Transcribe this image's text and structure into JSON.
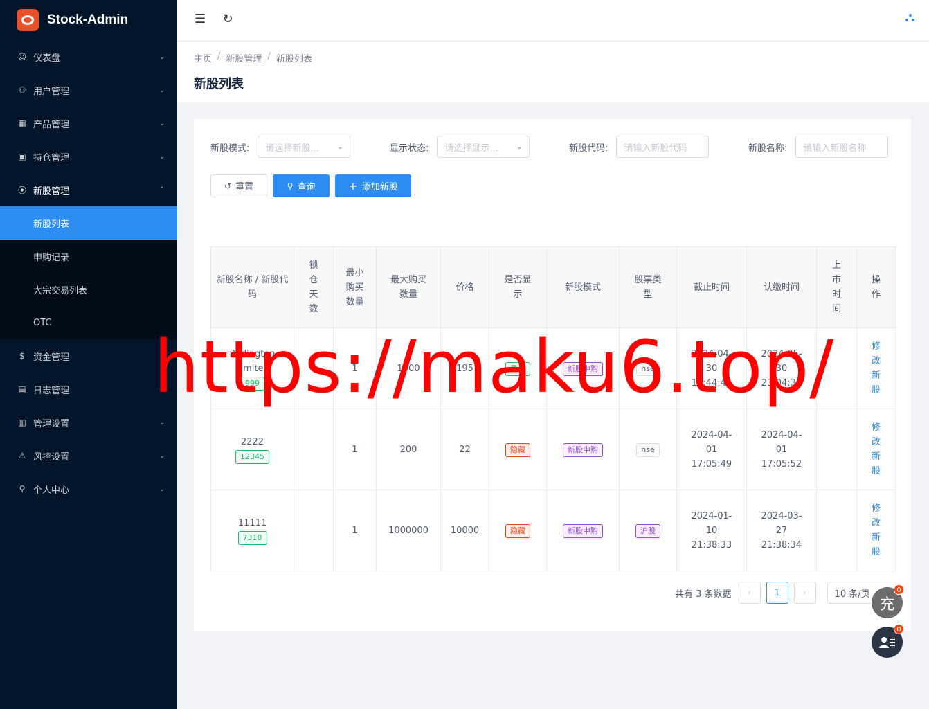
{
  "app": {
    "title": "Stock-Admin"
  },
  "sidebar": {
    "items": [
      {
        "label": "仪表盘",
        "icon": "dashboard-icon",
        "glyph": "☺",
        "arrow": "⌄"
      },
      {
        "label": "用户管理",
        "icon": "users-icon",
        "glyph": "⚇",
        "arrow": "⌄"
      },
      {
        "label": "产品管理",
        "icon": "chart-icon",
        "glyph": "▦",
        "arrow": "⌄"
      },
      {
        "label": "持仓管理",
        "icon": "position-icon",
        "glyph": "▣",
        "arrow": "⌄"
      },
      {
        "label": "新股管理",
        "icon": "ipo-icon",
        "glyph": "⦿",
        "arrow": "⌃"
      },
      {
        "label": "资金管理",
        "icon": "money-icon",
        "glyph": "$",
        "arrow": ""
      },
      {
        "label": "日志管理",
        "icon": "log-icon",
        "glyph": "▤",
        "arrow": ""
      },
      {
        "label": "管理设置",
        "icon": "settings-icon",
        "glyph": "▥",
        "arrow": "⌄"
      },
      {
        "label": "风控设置",
        "icon": "warning-icon",
        "glyph": "⚠",
        "arrow": "⌄"
      },
      {
        "label": "个人中心",
        "icon": "user-icon",
        "glyph": "⚲",
        "arrow": "⌄"
      }
    ],
    "submenu": [
      {
        "label": "新股列表"
      },
      {
        "label": "申购记录"
      },
      {
        "label": "大宗交易列表"
      },
      {
        "label": "OTC"
      }
    ]
  },
  "header": {
    "collapse_icon": "☰",
    "refresh_icon": "↻"
  },
  "breadcrumb": {
    "home": "主页",
    "section": "新股管理",
    "page": "新股列表",
    "sep": "/"
  },
  "page_title": "新股列表",
  "filters": {
    "mode": {
      "label": "新股模式:",
      "placeholder": "请选择新股..."
    },
    "display": {
      "label": "显示状态:",
      "placeholder": "请选择显示..."
    },
    "code": {
      "label": "新股代码:",
      "placeholder": "请输入新股代码"
    },
    "name": {
      "label": "新股名称:",
      "placeholder": "请输入新股名称"
    }
  },
  "buttons": {
    "reset": "重置",
    "search": "查询",
    "add": "添加新股"
  },
  "table": {
    "headers": [
      "新股名称 / 新股代码",
      "锁仓天数",
      "最小购买数量",
      "最大购买数量",
      "价格",
      "是否显示",
      "新股模式",
      "股票类型",
      "截止时间",
      "认缴时间",
      "上市时间",
      "操作"
    ],
    "rows": [
      {
        "name": "Redington Limited",
        "code": "999",
        "lock": "",
        "min": "1",
        "max": "1000",
        "price": "195",
        "show": "显示",
        "mode": "新股申购",
        "type": "nse",
        "deadline": "2024-04-30 10:44:44",
        "subscribe": "2024-05-30 23:04:30",
        "listing": "",
        "op": "修改新股"
      },
      {
        "name": "2222",
        "code": "12345",
        "lock": "",
        "min": "1",
        "max": "200",
        "price": "22",
        "show": "隐藏",
        "mode": "新股申购",
        "type": "nse",
        "deadline": "2024-04-01 17:05:49",
        "subscribe": "2024-04-01 17:05:52",
        "listing": "",
        "op": "修改新股"
      },
      {
        "name": "11111",
        "code": "7310",
        "lock": "",
        "min": "1",
        "max": "1000000",
        "price": "10000",
        "show": "隐藏",
        "mode": "新股申购",
        "type": "沪股",
        "deadline": "2024-01-10 21:38:33",
        "subscribe": "2024-03-27 21:38:34",
        "listing": "",
        "op": "修改新股"
      }
    ]
  },
  "pagination": {
    "total": "共有 3 条数据",
    "current": "1",
    "page_size": "10 条/页",
    "prev": "‹",
    "next": "›"
  },
  "floating": {
    "charge_label": "充",
    "charge_badge": "0",
    "chat_badge": "0"
  },
  "watermark": "https://maku6.top/",
  "colors": {
    "sidebar_bg": "#001529",
    "accent": "#2d8cf0",
    "logo": "#e8512a",
    "watermark": "#ff0000"
  }
}
